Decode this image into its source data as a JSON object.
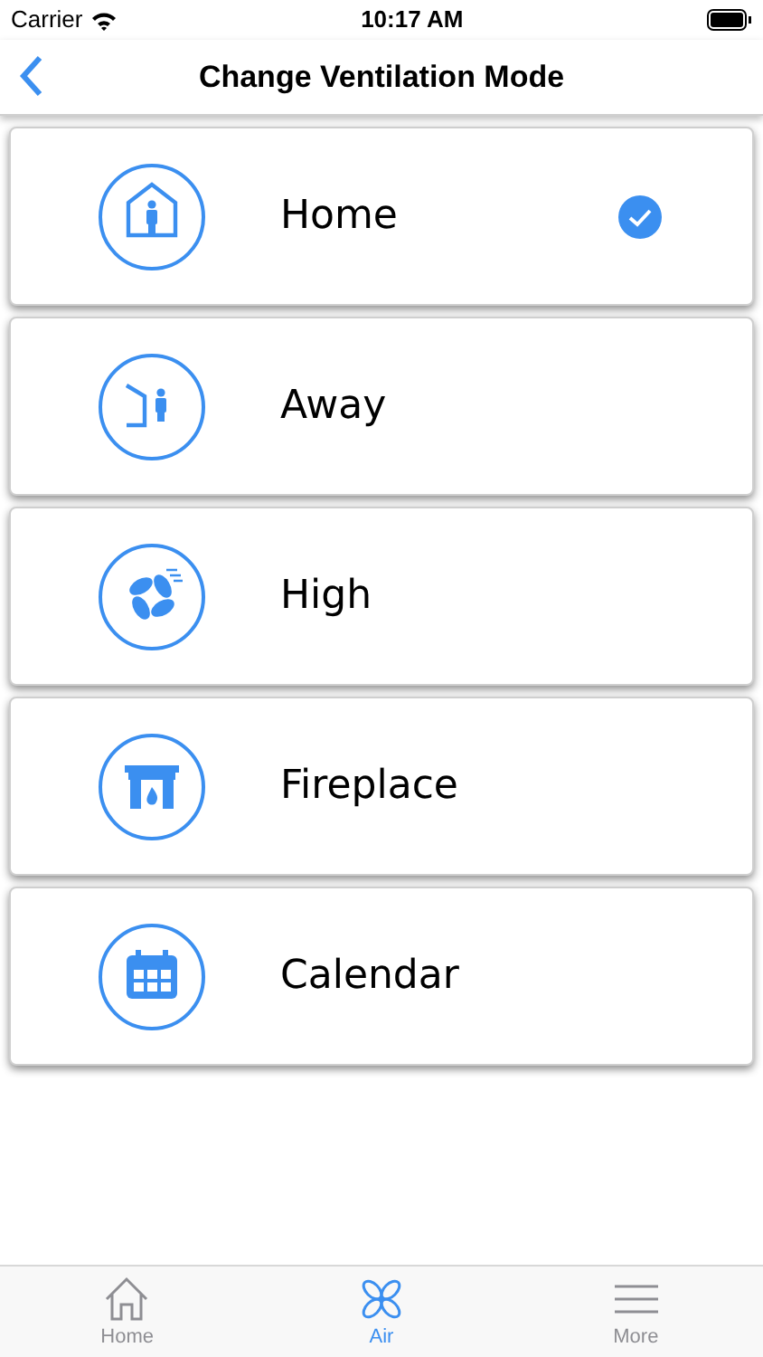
{
  "status_bar": {
    "carrier": "Carrier",
    "time": "10:17 AM"
  },
  "nav": {
    "title": "Change Ventilation Mode"
  },
  "modes": [
    {
      "kind": "home",
      "label": "Home",
      "selected": true
    },
    {
      "kind": "away",
      "label": "Away",
      "selected": false
    },
    {
      "kind": "high",
      "label": "High",
      "selected": false
    },
    {
      "kind": "fireplace",
      "label": "Fireplace",
      "selected": false
    },
    {
      "kind": "calendar",
      "label": "Calendar",
      "selected": false
    }
  ],
  "tab_bar": [
    {
      "kind": "home",
      "label": "Home",
      "selected": false
    },
    {
      "kind": "air",
      "label": "Air",
      "selected": true
    },
    {
      "kind": "more",
      "label": "More",
      "selected": false
    }
  ]
}
